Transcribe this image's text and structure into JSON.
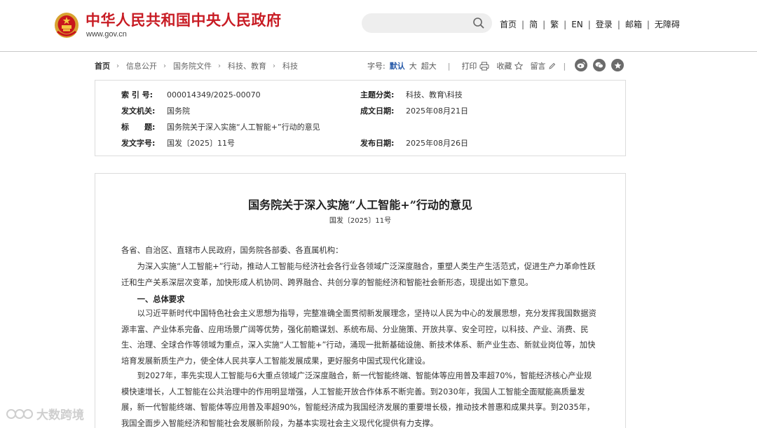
{
  "header": {
    "site_name": "中华人民共和国中央人民政府",
    "site_url": "www.gov.cn",
    "search": {
      "value": "",
      "placeholder": ""
    },
    "links": [
      "首页",
      "简",
      "繁",
      "EN",
      "登录",
      "邮箱",
      "无障碍"
    ]
  },
  "breadcrumb": [
    "首页",
    "信息公开",
    "国务院文件",
    "科技、教育",
    "科技"
  ],
  "tools": {
    "font_label": "字号:",
    "font_default": "默认",
    "font_large": "大",
    "font_xlarge": "超大",
    "print": "打印",
    "favorite": "收藏",
    "comment": "留言"
  },
  "share_icons": [
    "weibo-icon",
    "wechat-icon",
    "star-icon"
  ],
  "info": {
    "index_label": "索 引 号:",
    "index_value": "000014349/2025-00070",
    "category_label": "主题分类:",
    "category_value": "科技、教育\\科技",
    "issuer_label": "发文机关:",
    "issuer_value": "国务院",
    "date_written_label": "成文日期:",
    "date_written_value": "2025年08月21日",
    "title_label": "标　　题:",
    "title_value": "国务院关于深入实施“人工智能+”行动的意见",
    "docno_label": "发文字号:",
    "docno_value": "国发〔2025〕11号",
    "pub_date_label": "发布日期:",
    "pub_date_value": "2025年08月26日"
  },
  "article": {
    "title": "国务院关于深入实施“人工智能+”行动的意见",
    "doc_no": "国发〔2025〕11号",
    "salutation": "各省、自治区、直辖市人民政府，国务院各部委、各直属机构：",
    "intro": "为深入实施“人工智能+”行动，推动人工智能与经济社会各行业各领域广泛深度融合，重塑人类生产生活范式，促进生产力革命性跃迁和生产关系深层次变革，加快形成人机协同、跨界融合、共创分享的智能经济和智能社会新形态，现提出如下意见。",
    "section1": "一、总体要求",
    "para1": "以习近平新时代中国特色社会主义思想为指导，完整准确全面贯彻新发展理念，坚持以人民为中心的发展思想，充分发挥我国数据资源丰富、产业体系完备、应用场景广阔等优势，强化前瞻谋划、系统布局、分业施策、开放共享、安全可控，以科技、产业、消费、民生、治理、全球合作等领域为重点，深入实施“人工智能+”行动，涌现一批新基础设施、新技术体系、新产业生态、新就业岗位等，加快培育发展新质生产力，使全体人民共享人工智能发展成果，更好服务中国式现代化建设。",
    "para2": "到2027年，率先实现人工智能与6大重点领域广泛深度融合，新一代智能终端、智能体等应用普及率超70%，智能经济核心产业规模快速增长，人工智能在公共治理中的作用明显增强，人工智能开放合作体系不断完善。到2030年，我国人工智能全面赋能高质量发展，新一代智能终端、智能体等应用普及率超90%，智能经济成为我国经济发展的重要增长极，推动技术普惠和成果共享。到2035年，我国全面步入智能经济和智能社会发展新阶段，为基本实现社会主义现代化提供有力支撑。"
  },
  "watermark": "大数跨境",
  "colors": {
    "brand_red": "#c81c24",
    "link_blue": "#2a5caa"
  }
}
